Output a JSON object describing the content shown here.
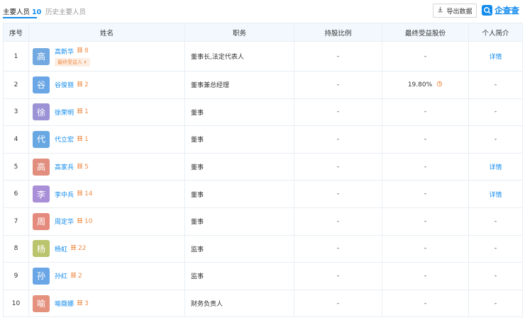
{
  "tabs": {
    "main_label": "主要人员",
    "main_count": "10",
    "history_label": "历史主要人员"
  },
  "toolbar": {
    "export_label": "导出数据",
    "export_icon": "download-icon"
  },
  "brand": {
    "name": "企查查",
    "color": "#128bed"
  },
  "table": {
    "headers": [
      "序号",
      "姓名",
      "职务",
      "持股比例",
      "最终受益股份",
      "个人简介"
    ],
    "rows": [
      {
        "index": "1",
        "avatar": "高",
        "avatar_color": "#72a9e0",
        "name": "高新华",
        "assoc": "8",
        "tag": "最终受益人",
        "position": "董事长,法定代表人",
        "share": "-",
        "final_share": "-",
        "bio": "详情"
      },
      {
        "index": "2",
        "avatar": "谷",
        "avatar_color": "#6aa6e6",
        "name": "谷俊丽",
        "assoc": "2",
        "tag": "",
        "position": "董事兼总经理",
        "share": "-",
        "final_share": "19.80%",
        "bio": "-"
      },
      {
        "index": "3",
        "avatar": "徐",
        "avatar_color": "#9c92d6",
        "name": "徐荣明",
        "assoc": "1",
        "tag": "",
        "position": "董事",
        "share": "-",
        "final_share": "-",
        "bio": "-"
      },
      {
        "index": "4",
        "avatar": "代",
        "avatar_color": "#68a8e2",
        "name": "代立宏",
        "assoc": "1",
        "tag": "",
        "position": "董事",
        "share": "-",
        "final_share": "-",
        "bio": "-"
      },
      {
        "index": "5",
        "avatar": "高",
        "avatar_color": "#e18e7e",
        "name": "高家兵",
        "assoc": "5",
        "tag": "",
        "position": "董事",
        "share": "-",
        "final_share": "-",
        "bio": "详情"
      },
      {
        "index": "6",
        "avatar": "李",
        "avatar_color": "#a98ed8",
        "name": "李中兵",
        "assoc": "14",
        "tag": "",
        "position": "董事",
        "share": "-",
        "final_share": "-",
        "bio": "详情"
      },
      {
        "index": "7",
        "avatar": "周",
        "avatar_color": "#e58b7e",
        "name": "周定华",
        "assoc": "10",
        "tag": "",
        "position": "董事",
        "share": "-",
        "final_share": "-",
        "bio": "-"
      },
      {
        "index": "8",
        "avatar": "杨",
        "avatar_color": "#b9c46c",
        "name": "杨虹",
        "assoc": "22",
        "tag": "",
        "position": "监事",
        "share": "-",
        "final_share": "-",
        "bio": "-"
      },
      {
        "index": "9",
        "avatar": "孙",
        "avatar_color": "#6aa6e6",
        "name": "孙红",
        "assoc": "2",
        "tag": "",
        "position": "监事",
        "share": "-",
        "final_share": "-",
        "bio": "-"
      },
      {
        "index": "10",
        "avatar": "喻",
        "avatar_color": "#e4917e",
        "name": "喻薇娜",
        "assoc": "3",
        "tag": "",
        "position": "财务负责人",
        "share": "-",
        "final_share": "-",
        "bio": "-"
      }
    ]
  },
  "colors": {
    "accent": "#128bed",
    "assoc": "#f08d49",
    "header_bg": "#f2f8fe"
  }
}
